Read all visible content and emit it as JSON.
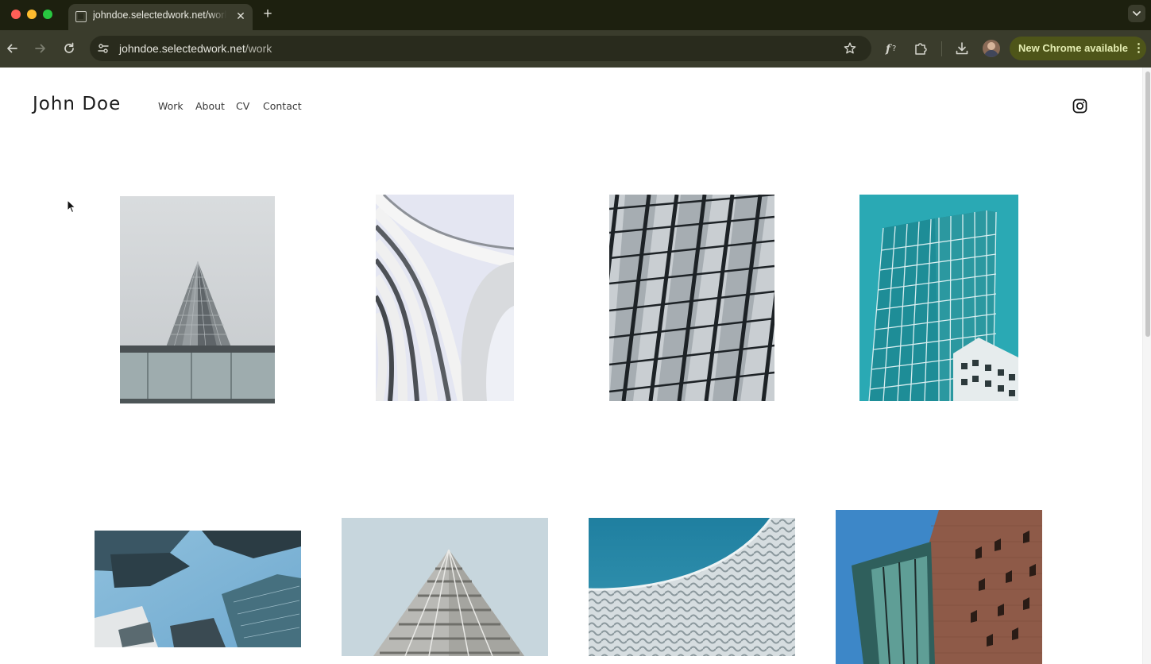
{
  "browser": {
    "tab_title": "johndoe.selectedwork.net/work",
    "new_tab_icon": "plus-icon",
    "url_host": "johndoe.selectedwork.net",
    "url_path": "/work",
    "update_label": "New Chrome available",
    "colors": {
      "frame": "#1d200f",
      "toolbar": "#3a3c2c",
      "update_pill": "#4e5519"
    }
  },
  "site": {
    "title": "John Doe",
    "nav": [
      {
        "label": "Work"
      },
      {
        "label": "About"
      },
      {
        "label": "CV"
      },
      {
        "label": "Contact"
      }
    ],
    "social_icon": "instagram-icon"
  },
  "gallery": {
    "items": [
      {
        "subject": "skyscraper-from-below-grey-sky"
      },
      {
        "subject": "curved-white-balconies"
      },
      {
        "subject": "dark-window-grid-facade"
      },
      {
        "subject": "glass-tower-teal-sky"
      },
      {
        "subject": "towers-looking-up-blue-sky"
      },
      {
        "subject": "stepped-concrete-pyramid"
      },
      {
        "subject": "woven-metal-facade"
      },
      {
        "subject": "brick-and-glass-building"
      }
    ]
  }
}
